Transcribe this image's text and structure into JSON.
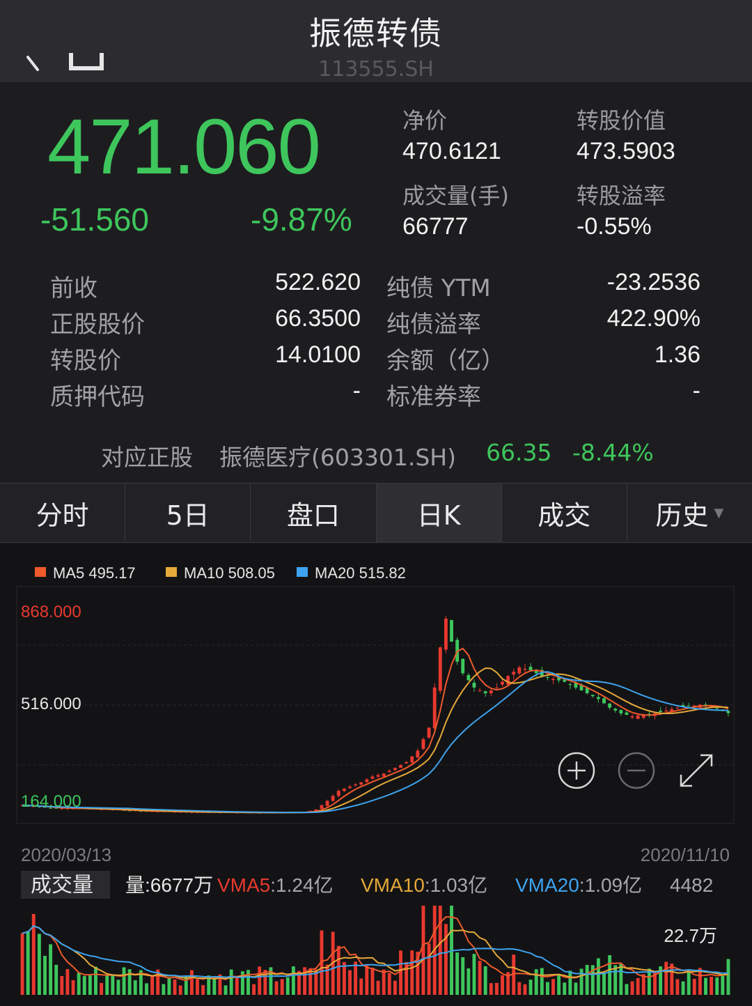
{
  "header": {
    "title": "振德转债",
    "code": "113555.SH"
  },
  "quote": {
    "price": "471.060",
    "change": "-51.560",
    "change_pct": "-9.87%",
    "net_price_label": "净价",
    "net_price": "470.6121",
    "conv_value_label": "转股价值",
    "conv_value": "473.5903",
    "volume_label": "成交量(手)",
    "volume": "66777",
    "premium_label": "转股溢率",
    "premium": "-0.55%"
  },
  "details": {
    "left": [
      {
        "label": "前收",
        "value": "522.620"
      },
      {
        "label": "正股股价",
        "value": "66.3500"
      },
      {
        "label": "转股价",
        "value": "14.0100"
      },
      {
        "label": "质押代码",
        "value": "-"
      }
    ],
    "right": [
      {
        "label": "纯债 YTM",
        "value": "-23.2536"
      },
      {
        "label": "纯债溢率",
        "value": "422.90%"
      },
      {
        "label": "余额（亿）",
        "value": "1.36"
      },
      {
        "label": "标准券率",
        "value": "-"
      }
    ]
  },
  "underlying": {
    "label": "对应正股",
    "name": "振德医疗(603301.SH)",
    "price": "66.35",
    "change_pct": "-8.44%"
  },
  "tabs": [
    {
      "label": "分时",
      "active": false
    },
    {
      "label": "5日",
      "active": false
    },
    {
      "label": "盘口",
      "active": false
    },
    {
      "label": "日K",
      "active": true
    },
    {
      "label": "成交",
      "active": false
    },
    {
      "label": "历史",
      "active": false
    }
  ],
  "colors": {
    "up": "#e8392f",
    "down": "#3ec65c",
    "ma5": "#ee5a2c",
    "ma10": "#e6a93b",
    "ma20": "#3ea3ee"
  },
  "chart_data": {
    "type": "candlestick",
    "legend": [
      {
        "name": "MA5",
        "value": "495.17"
      },
      {
        "name": "MA10",
        "value": "508.05"
      },
      {
        "name": "MA20",
        "value": "515.82"
      }
    ],
    "y_ticks": [
      "868.000",
      "516.000",
      "164.000"
    ],
    "ylim": [
      164,
      868
    ],
    "date_start": "2020/03/13",
    "date_end": "2020/11/10",
    "close_profile": [
      [
        0,
        150
      ],
      [
        5,
        140
      ],
      [
        10,
        138
      ],
      [
        15,
        135
      ],
      [
        20,
        130
      ],
      [
        25,
        128
      ],
      [
        30,
        126
      ],
      [
        35,
        125
      ],
      [
        40,
        124
      ],
      [
        45,
        124
      ],
      [
        50,
        126
      ],
      [
        52,
        135
      ],
      [
        54,
        165
      ],
      [
        56,
        200
      ],
      [
        58,
        215
      ],
      [
        60,
        230
      ],
      [
        62,
        250
      ],
      [
        64,
        260
      ],
      [
        66,
        280
      ],
      [
        68,
        300
      ],
      [
        70,
        340
      ],
      [
        72,
        420
      ],
      [
        73,
        560
      ],
      [
        74,
        700
      ],
      [
        75,
        800
      ],
      [
        76,
        720
      ],
      [
        77,
        650
      ],
      [
        78,
        610
      ],
      [
        80,
        560
      ],
      [
        82,
        540
      ],
      [
        84,
        560
      ],
      [
        86,
        600
      ],
      [
        88,
        630
      ],
      [
        90,
        620
      ],
      [
        92,
        600
      ],
      [
        94,
        590
      ],
      [
        96,
        580
      ],
      [
        98,
        560
      ],
      [
        100,
        540
      ],
      [
        102,
        520
      ],
      [
        104,
        490
      ],
      [
        106,
        470
      ],
      [
        108,
        460
      ],
      [
        110,
        465
      ],
      [
        112,
        470
      ],
      [
        114,
        480
      ],
      [
        116,
        490
      ],
      [
        118,
        495
      ],
      [
        120,
        500
      ],
      [
        122,
        495
      ],
      [
        124,
        480
      ],
      [
        125,
        471
      ]
    ],
    "volume_panel": {
      "label": "成交量",
      "volume": "量:6677万",
      "vma5_label": "VMA5",
      "vma5": "1.24亿",
      "vma10_label": "VMA10",
      "vma10": "1.03亿",
      "vma20_label": "VMA20",
      "vma20": "1.09亿",
      "extra": "4482",
      "mid_label": "22.7万"
    }
  }
}
